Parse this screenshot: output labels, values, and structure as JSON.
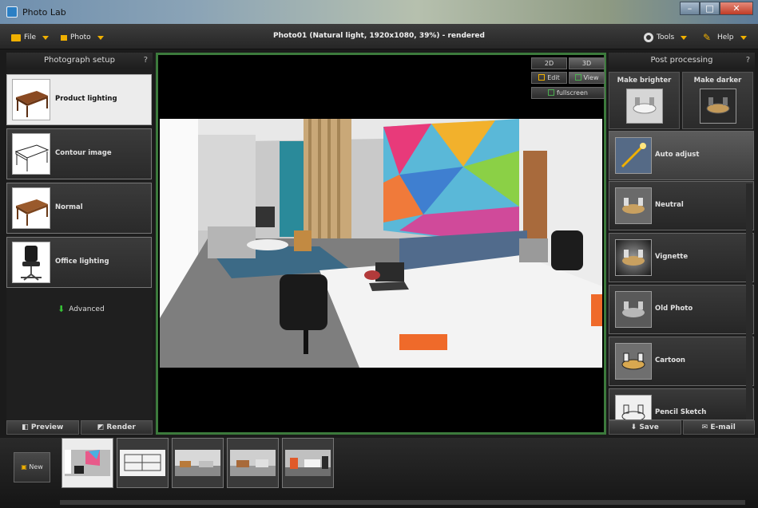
{
  "window": {
    "app_title": "Photo Lab"
  },
  "menubar": {
    "file_label": "File",
    "photo_label": "Photo",
    "document_title": "Photo01 (Natural light, 1920x1080, 39%) - rendered",
    "tools_label": "Tools",
    "help_label": "Help"
  },
  "left_panel": {
    "title": "Photograph setup",
    "help": "?",
    "items": [
      {
        "label": "Product lighting",
        "selected": true,
        "icon": "wooden-table-icon"
      },
      {
        "label": "Contour image",
        "selected": false,
        "icon": "table-outline-icon"
      },
      {
        "label": "Normal",
        "selected": false,
        "icon": "wooden-table-icon"
      },
      {
        "label": "Office lighting",
        "selected": false,
        "icon": "office-chair-icon"
      }
    ],
    "advanced_label": "Advanced",
    "preview_label": "Preview",
    "render_label": "Render"
  },
  "viewport": {
    "btn_2d": "2D",
    "btn_3d": "3D",
    "edit_label": "Edit",
    "view_label": "View",
    "fullscreen_label": "fullscreen",
    "active_mode": "3D"
  },
  "right_panel": {
    "title": "Post processing",
    "help": "?",
    "make_brighter": "Make brighter",
    "make_darker": "Make darker",
    "items": [
      {
        "label": "Auto adjust",
        "icon": "magic-wand-icon"
      },
      {
        "label": "Neutral"
      },
      {
        "label": "Vignette"
      },
      {
        "label": "Old Photo"
      },
      {
        "label": "Cartoon"
      },
      {
        "label": "Pencil Sketch"
      }
    ],
    "save_label": "Save",
    "email_label": "E-mail"
  },
  "filmstrip": {
    "new_label": "New",
    "thumbnails": [
      {
        "name": "photo-1",
        "selected": true
      },
      {
        "name": "photo-2",
        "selected": false
      },
      {
        "name": "photo-3",
        "selected": false
      },
      {
        "name": "photo-4",
        "selected": false
      },
      {
        "name": "photo-5",
        "selected": false
      }
    ]
  },
  "colors": {
    "accent": "#f0b000",
    "viewport_border": "#3c7a3c",
    "panel_bg": "#1f1f1f"
  }
}
